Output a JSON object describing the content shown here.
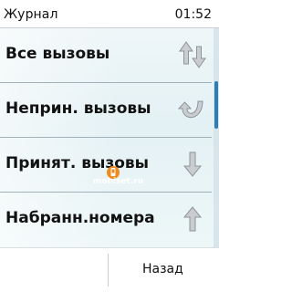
{
  "status": {
    "title": "Журнал",
    "time": "01:52"
  },
  "menu": {
    "items": [
      {
        "label": "Все вызовы",
        "icon": "all-calls-arrows-icon"
      },
      {
        "label": "Неприн. вызовы",
        "icon": "missed-call-curved-arrow-icon"
      },
      {
        "label": "Принят. вызовы",
        "icon": "received-call-down-arrow-icon"
      },
      {
        "label": "Набранн.номера",
        "icon": "dialed-call-up-arrow-icon"
      }
    ]
  },
  "watermark": {
    "text": "mobiset.ru"
  },
  "softkeys": {
    "right": "Назад"
  },
  "colors": {
    "accent": "#2b7fb6",
    "arrow_fill": "#c9cdd0",
    "arrow_stroke": "#8f9497"
  }
}
